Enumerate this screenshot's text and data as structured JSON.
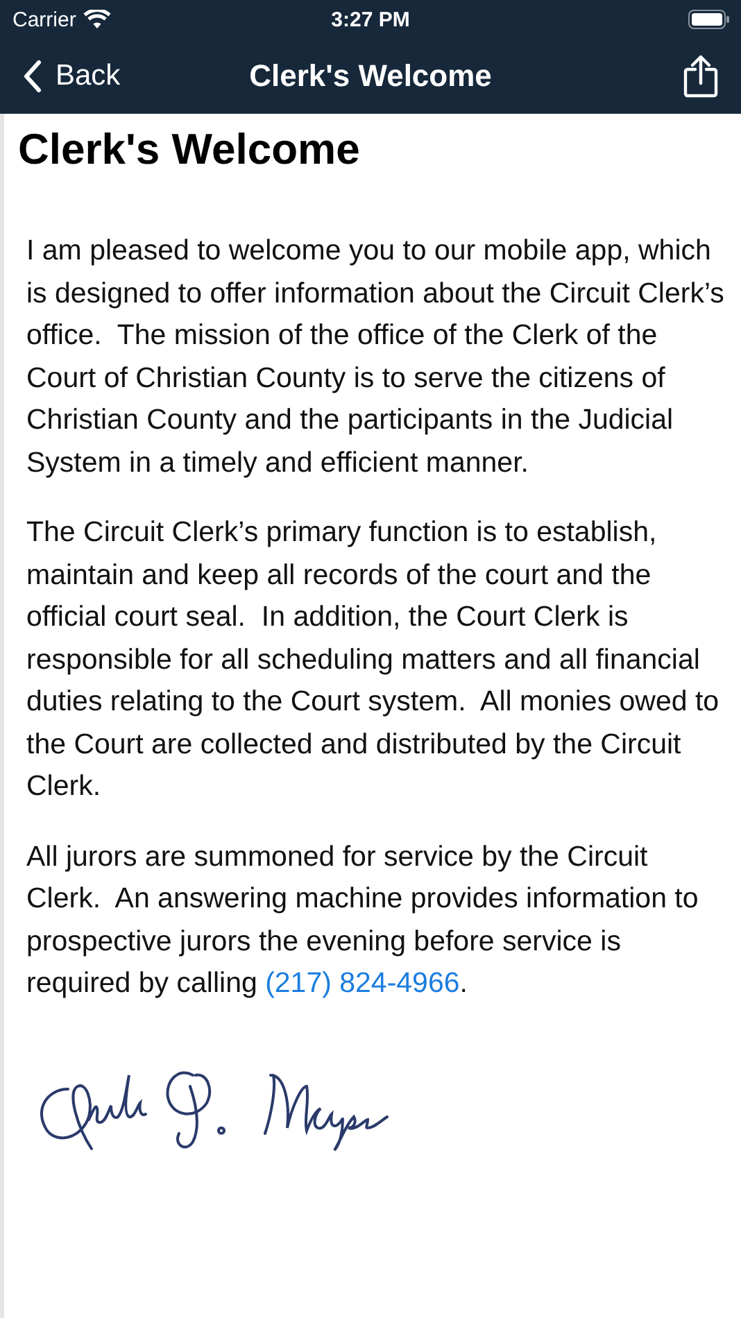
{
  "status_bar": {
    "carrier": "Carrier",
    "time": "3:27 PM"
  },
  "nav_bar": {
    "back": "Back",
    "title": "Clerk's Welcome"
  },
  "heading": "Clerk's Welcome",
  "paragraphs": [
    {
      "text": "I am pleased to welcome you to our mobile app, which is designed to offer information about the Circuit Clerk’s office.  The mission of the office of the Clerk of the Court of Christian County is to serve the citizens of Christian County and the participants in the Judicial System in a timely and efficient manner."
    },
    {
      "text": "The Circuit Clerk’s primary function is to establish, maintain and keep all records of the court and the official court seal.  In addition, the Court Clerk is responsible for all scheduling matters and all financial duties relating to the Court system.  All monies owed to the Court are collected and distributed by the Circuit Clerk."
    },
    {
      "text": "All jurors are summoned for service by the Circuit Clerk.  An answering machine provides information to prospective jurors the evening before service is required by calling ",
      "link": "(217) 824-4966",
      "after": "."
    }
  ]
}
